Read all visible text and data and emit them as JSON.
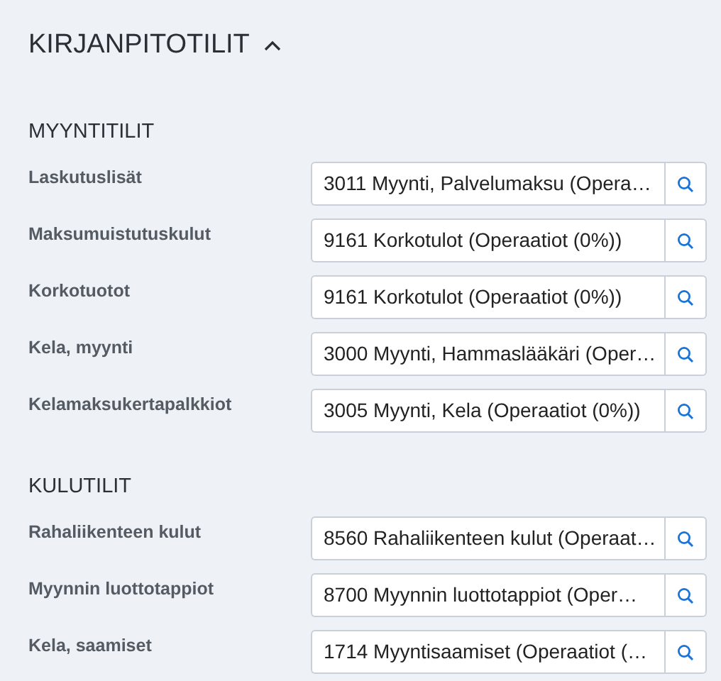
{
  "header": {
    "title": "KIRJANPITOTILIT",
    "expanded": true
  },
  "sections": [
    {
      "title": "MYYNTITILIT",
      "rows": [
        {
          "label": "Laskutuslisät",
          "value": "3011 Myynti, Palvelumaksu (Opera…"
        },
        {
          "label": "Maksumuistutuskulut",
          "value": "9161 Korkotulot (Operaatiot (0%))"
        },
        {
          "label": "Korkotuotot",
          "value": "9161 Korkotulot (Operaatiot (0%))"
        },
        {
          "label": "Kela, myynti",
          "value": "3000 Myynti, Hammaslääkäri (Oper…"
        },
        {
          "label": "Kelamaksukertapalkkiot",
          "value": "3005 Myynti, Kela (Operaatiot (0%))"
        }
      ]
    },
    {
      "title": "KULUTILIT",
      "rows": [
        {
          "label": "Rahaliikenteen kulut",
          "value": "8560 Rahaliikenteen kulut (Operaat…"
        },
        {
          "label": "Myynnin luottotappiot",
          "value": "8700 Myynnin luottotappiot (Oper…"
        },
        {
          "label": "Kela, saamiset",
          "value": "1714 Myyntisaamiset (Operaatiot (…"
        }
      ]
    }
  ]
}
